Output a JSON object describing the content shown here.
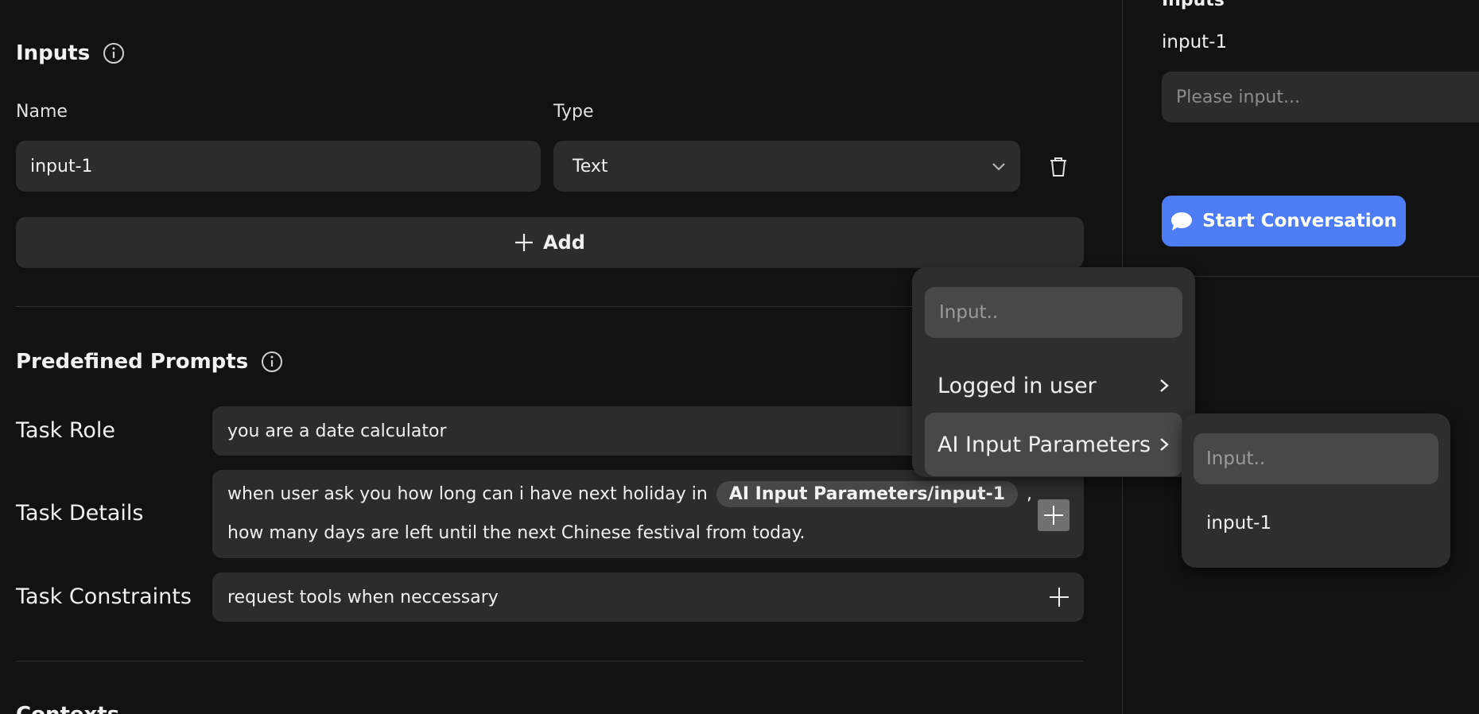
{
  "inputs_section": {
    "title": "Inputs",
    "name_label": "Name",
    "type_label": "Type",
    "row": {
      "name_value": "input-1",
      "type_value": "Text"
    },
    "add_label": "Add"
  },
  "prompts_section": {
    "title": "Predefined Prompts",
    "task_role": {
      "label": "Task Role",
      "value": "you are a date calculator"
    },
    "task_details": {
      "label": "Task Details",
      "text_before": "when user ask you how long can i have next holiday in",
      "chip": "AI Input Parameters/input-1",
      "text_after": ",",
      "line2": "how many days are left until the next Chinese festival from today."
    },
    "task_constraints": {
      "label": "Task Constraints",
      "value": "request tools when neccessary"
    }
  },
  "next_section": {
    "title": "Contexts"
  },
  "preview": {
    "heading": "Inputs",
    "field_label": "input-1",
    "placeholder": "Please input...",
    "start_button": "Start Conversation",
    "accent": "#4e7cf5"
  },
  "variable_menu": {
    "search_placeholder": "Input..",
    "items": [
      "Logged in user",
      "AI Input Parameters"
    ]
  },
  "submenu": {
    "search_placeholder": "Input..",
    "items": [
      "input-1"
    ]
  }
}
